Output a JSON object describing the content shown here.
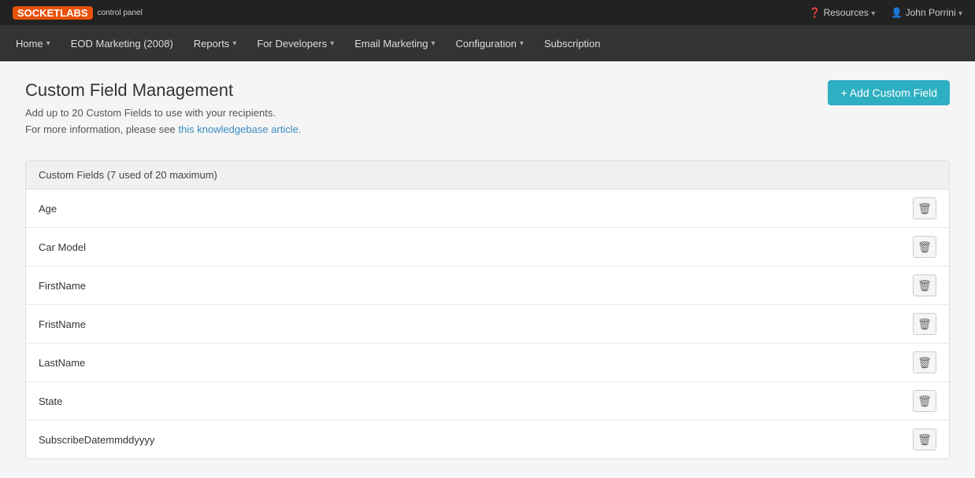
{
  "topbar": {
    "logo_text": "SOCKETLABS",
    "logo_sub": "control panel",
    "resources_label": "Resources",
    "user_label": "John Porrini"
  },
  "navbar": {
    "items": [
      {
        "id": "home",
        "label": "Home",
        "has_dropdown": true
      },
      {
        "id": "eod-marketing",
        "label": "EOD Marketing (2008)",
        "has_dropdown": false
      },
      {
        "id": "reports",
        "label": "Reports",
        "has_dropdown": true
      },
      {
        "id": "for-developers",
        "label": "For Developers",
        "has_dropdown": true
      },
      {
        "id": "email-marketing",
        "label": "Email Marketing",
        "has_dropdown": true
      },
      {
        "id": "configuration",
        "label": "Configuration",
        "has_dropdown": true
      },
      {
        "id": "subscription",
        "label": "Subscription",
        "has_dropdown": false
      }
    ]
  },
  "page": {
    "title": "Custom Field Management",
    "subtitle": "Add up to 20 Custom Fields to use with your recipients.",
    "kb_text": "For more information, please see ",
    "kb_link_label": "this knowledgebase article.",
    "add_button_label": "+ Add Custom Field"
  },
  "panel": {
    "header": "Custom Fields (7 used of 20 maximum)",
    "fields": [
      {
        "id": "age",
        "name": "Age"
      },
      {
        "id": "car-model",
        "name": "Car Model"
      },
      {
        "id": "firstname",
        "name": "FirstName"
      },
      {
        "id": "fristname",
        "name": "FristName"
      },
      {
        "id": "lastname",
        "name": "LastName"
      },
      {
        "id": "state",
        "name": "State"
      },
      {
        "id": "subscribe-date",
        "name": "SubscribeDatemmddyyyy"
      }
    ]
  }
}
